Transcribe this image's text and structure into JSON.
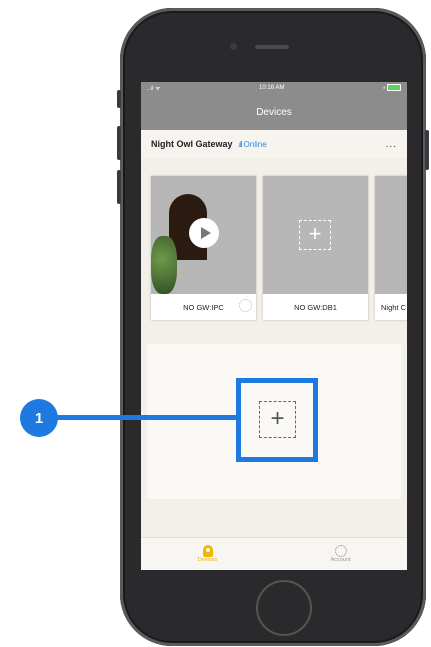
{
  "status_bar": {
    "signal": "..ıl ᯤ",
    "time": "10:16 AM",
    "battery_text": "* "
  },
  "header": {
    "title": "Devices"
  },
  "gateway": {
    "name": "Night Owl Gateway",
    "signal": ".ıll",
    "status": "Online",
    "more": "..."
  },
  "cards": [
    {
      "label": "NO GW:IPC"
    },
    {
      "label": "NO GW:DB1"
    },
    {
      "label": "Night C"
    }
  ],
  "tabs": [
    {
      "label": "Devices",
      "active": true
    },
    {
      "label": "Account",
      "active": false
    }
  ],
  "callout": {
    "number": "1"
  },
  "colors": {
    "accent": "#1e7ae0",
    "tab_active": "#e9b100",
    "online": "#2b8de0"
  }
}
